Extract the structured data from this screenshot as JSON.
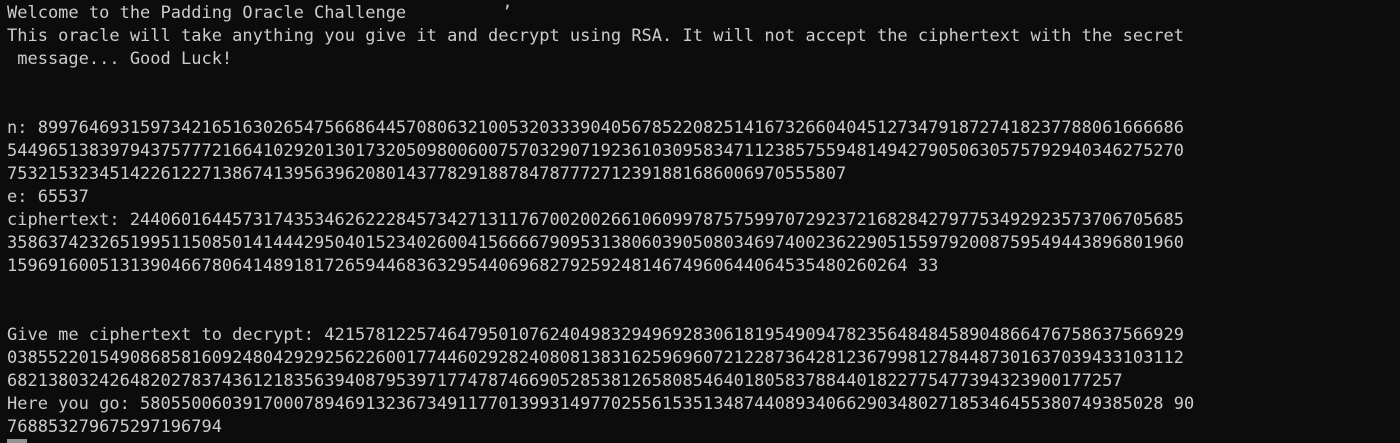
{
  "terminal": {
    "colors": {
      "background": "#0c0c0c",
      "foreground": "#cccccc"
    },
    "lines": [
      "Welcome to the Padding Oracle Challenge",
      "This oracle will take anything you give it and decrypt using RSA. It will not accept the ciphertext with the secret",
      " message... Good Luck!",
      "",
      "",
      "n: 8997646931597342165163026547566864457080632100532033390405678522082514167326604045127347918727418237788061666686",
      "5449651383979437577721664102920130173205098006007570329071923610309583471123857559481494279050630575792940346275270",
      "7532153234514226122713867413956396208014377829188784787772712391881686006970555807",
      "e: 65537",
      "ciphertext: 2440601644573174353462622284573427131176700200266106099787575997072923721682842797753492923573706705685",
      "3586374232651995115085014144429504015234026004156666790953138060390508034697400236229051559792008759549443896801960",
      "1596916005131390466780641489181726594468363295440696827925924814674960644064535480260264 33",
      "",
      "",
      "Give me ciphertext to decrypt: 421578122574647950107624049832949692830618195490947823564848458904866476758637566929",
      "0385522015490868581609248042929256226001774460292824080813831625969607212287364281236799812784487301637039433103112",
      "6821380324264820278374361218356394087953971774787466905285381265808546401805837884401822775477394323900177257",
      "Here you go: 5805500603917000789469132367349117701399314977025561535134874408934066290348027185346455380749385028 90",
      "768853279675297196794"
    ]
  }
}
